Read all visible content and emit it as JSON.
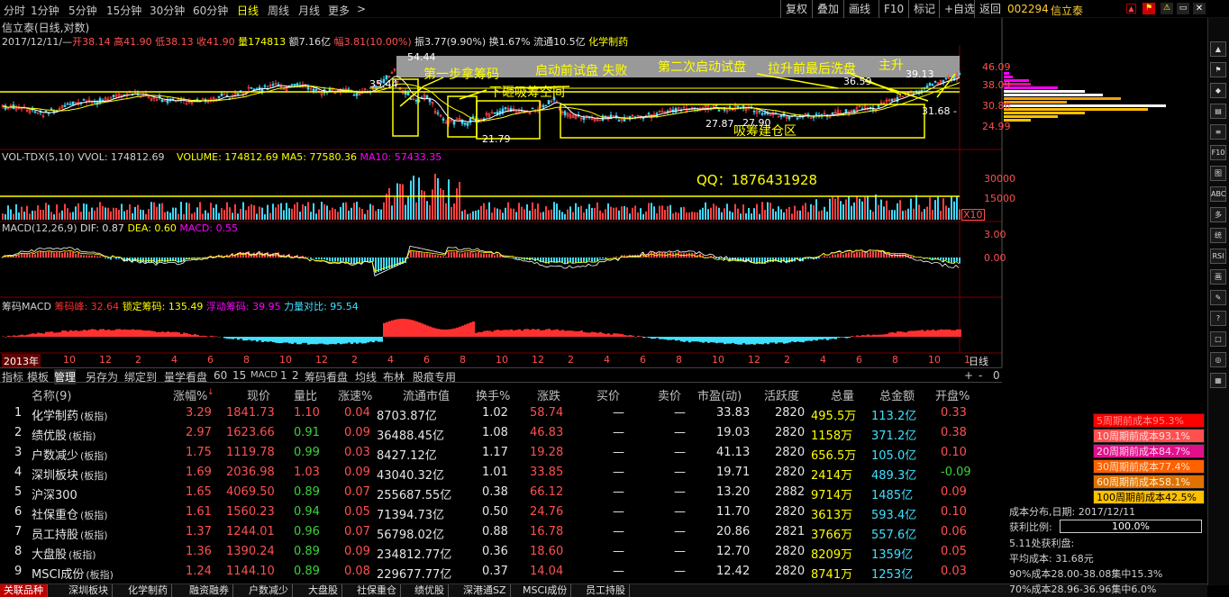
{
  "topbar": {
    "periods": [
      "分时",
      "1分钟",
      "5分钟",
      "15分钟",
      "30分钟",
      "60分钟",
      "日线",
      "周线",
      "月线",
      "更多"
    ],
    "active_period": "日线",
    "more_arrow": ">",
    "buttons": [
      "复权",
      "叠加",
      "画线",
      "F10",
      "标记",
      "+自选",
      "返回"
    ],
    "stock_code": "002294",
    "stock_name": "信立泰"
  },
  "chart_header": {
    "title": "信立泰(日线,对数)",
    "date": "2017/12/11/—",
    "open_label": "开",
    "open": "38.14",
    "high_label": "高",
    "high": "41.90",
    "low_label": "低",
    "low": "38.13",
    "close_label": "收",
    "close": "41.90",
    "vol_label": "量",
    "vol": "174813",
    "amount_label": "额",
    "amount": "7.16亿",
    "change_label": "幅",
    "change": "3.81(10.00%)",
    "amp_label": "振",
    "amp": "3.77(9.90%)",
    "turnover_label": "换",
    "turnover": "1.67%",
    "float_label": "流通",
    "float": "10.5亿",
    "industry": "化学制药"
  },
  "price_axis": [
    "46.09",
    "38.09",
    "30.86",
    "24.99"
  ],
  "annotations": {
    "a1": "第一步拿筹码",
    "a2": "启动前试盘 失败",
    "a3": "第二次启动试盘",
    "a4": "拉升前最后洗盘",
    "a5": "主升",
    "a6": "下砸吸筹空间",
    "a7": "吸筹建仓区",
    "p1": "54.44",
    "p2": "35.44",
    "p3": "21.79",
    "p4": "27.87",
    "p5": "27.90",
    "p6": "36.59",
    "p7": "39.13",
    "p8": "31.68 -",
    "qq": "QQ：1876431928"
  },
  "vol_panel": {
    "title": "VOL-TDX(5,10)",
    "vvol": "VVOL: 174812.69",
    "volume": "VOLUME: 174812.69",
    "ma5": "MA5: 77580.36",
    "ma10": "MA10: 57433.35",
    "axis": [
      "30000",
      "15000"
    ],
    "mult": "X10"
  },
  "macd_panel": {
    "title": "MACD(12,26,9)",
    "dif": "DIF: 0.87",
    "dea": "DEA: 0.60",
    "macd": "MACD: 0.55",
    "axis": [
      "3.00",
      "0.00"
    ]
  },
  "chip_panel": {
    "title": "筹码MACD",
    "peak": "筹码峰: 32.64",
    "lock": "锁定筹码: 135.49",
    "float": "浮动筹码: 39.95",
    "power": "力量对比: 95.54"
  },
  "time_axis": {
    "year": "2013年",
    "months": [
      "10",
      "12",
      "2",
      "4",
      "6",
      "8",
      "10",
      "12",
      "2",
      "4",
      "6",
      "8",
      "10",
      "12",
      "2",
      "4",
      "6",
      "8",
      "10",
      "12",
      "2",
      "4",
      "6",
      "8",
      "10",
      "1"
    ],
    "period_label": "日线"
  },
  "strip": {
    "items": [
      "指标",
      "模板",
      "管理",
      "另存为",
      "绑定到",
      "量学看盘",
      "60",
      "15",
      "MACD",
      "1",
      "2",
      "筹码看盘",
      "均线",
      "布林",
      "股痕专用"
    ],
    "active": "管理",
    "right": [
      "+",
      "-",
      "0"
    ]
  },
  "table": {
    "headers": [
      "名称(9)",
      "涨幅%",
      "现价",
      "量比",
      "涨速%",
      "流通市值",
      "换手%",
      "涨跌",
      "买价",
      "卖价",
      "市盈(动)",
      "活跃度",
      "总量",
      "总金额",
      "开盘%"
    ],
    "rows": [
      {
        "no": "1",
        "name": "化学制药",
        "tag": "(板指)",
        "chg": "3.29",
        "price": "1841.73",
        "vr": "1.10",
        "spd": "0.04",
        "mcap": "8703.87亿",
        "turn": "1.02",
        "diff": "58.74",
        "bid": "—",
        "ask": "—",
        "pe": "33.83",
        "act": "2820",
        "vol": "495.5万",
        "amt": "113.2亿",
        "open": "0.33"
      },
      {
        "no": "2",
        "name": "绩优股",
        "tag": "(板指)",
        "chg": "2.97",
        "price": "1623.66",
        "vr": "0.91",
        "spd": "0.09",
        "mcap": "36488.45亿",
        "turn": "1.08",
        "diff": "46.83",
        "bid": "—",
        "ask": "—",
        "pe": "19.03",
        "act": "2820",
        "vol": "1158万",
        "amt": "371.2亿",
        "open": "0.38"
      },
      {
        "no": "3",
        "name": "户数减少",
        "tag": "(板指)",
        "chg": "1.75",
        "price": "1119.78",
        "vr": "0.99",
        "spd": "0.03",
        "mcap": "8427.12亿",
        "turn": "1.17",
        "diff": "19.28",
        "bid": "—",
        "ask": "—",
        "pe": "41.13",
        "act": "2820",
        "vol": "656.5万",
        "amt": "105.0亿",
        "open": "0.10"
      },
      {
        "no": "4",
        "name": "深圳板块",
        "tag": "(板指)",
        "chg": "1.69",
        "price": "2036.98",
        "vr": "1.03",
        "spd": "0.09",
        "mcap": "43040.32亿",
        "turn": "1.01",
        "diff": "33.85",
        "bid": "—",
        "ask": "—",
        "pe": "19.71",
        "act": "2820",
        "vol": "2414万",
        "amt": "489.3亿",
        "open": "-0.09"
      },
      {
        "no": "5",
        "name": "沪深300",
        "tag": "",
        "chg": "1.65",
        "price": "4069.50",
        "vr": "0.89",
        "spd": "0.07",
        "mcap": "255687.55亿",
        "turn": "0.38",
        "diff": "66.12",
        "bid": "—",
        "ask": "—",
        "pe": "13.20",
        "act": "2882",
        "vol": "9714万",
        "amt": "1485亿",
        "open": "0.09"
      },
      {
        "no": "6",
        "name": "社保重仓",
        "tag": "(板指)",
        "chg": "1.61",
        "price": "1560.23",
        "vr": "0.94",
        "spd": "0.05",
        "mcap": "71394.73亿",
        "turn": "0.50",
        "diff": "24.76",
        "bid": "—",
        "ask": "—",
        "pe": "11.70",
        "act": "2820",
        "vol": "3613万",
        "amt": "593.4亿",
        "open": "0.10"
      },
      {
        "no": "7",
        "name": "员工持股",
        "tag": "(板指)",
        "chg": "1.37",
        "price": "1244.01",
        "vr": "0.96",
        "spd": "0.07",
        "mcap": "56798.02亿",
        "turn": "0.88",
        "diff": "16.78",
        "bid": "—",
        "ask": "—",
        "pe": "20.86",
        "act": "2821",
        "vol": "3766万",
        "amt": "557.6亿",
        "open": "0.06"
      },
      {
        "no": "8",
        "name": "大盘股",
        "tag": "(板指)",
        "chg": "1.36",
        "price": "1390.24",
        "vr": "0.89",
        "spd": "0.09",
        "mcap": "234812.77亿",
        "turn": "0.36",
        "diff": "18.60",
        "bid": "—",
        "ask": "—",
        "pe": "12.70",
        "act": "2820",
        "vol": "8209万",
        "amt": "1359亿",
        "open": "0.05"
      },
      {
        "no": "9",
        "name": "MSCI成份",
        "tag": "(板指)",
        "chg": "1.24",
        "price": "1144.10",
        "vr": "0.89",
        "spd": "0.08",
        "mcap": "229677.77亿",
        "turn": "0.37",
        "diff": "14.04",
        "bid": "—",
        "ask": "—",
        "pe": "12.42",
        "act": "2820",
        "vol": "8741万",
        "amt": "1253亿",
        "open": "0.03"
      }
    ]
  },
  "bottom_tabs": [
    "关联品种",
    "深圳板块",
    "化学制药",
    "融资融券",
    "户数减少",
    "大盘股",
    "社保重仓",
    "绩优股",
    "深港通SZ",
    "MSCI成份",
    "员工持股"
  ],
  "bottom_active": "关联品种",
  "cost_panel": {
    "rows": [
      {
        "label": "5周期前成本95.3%",
        "bg": "#ff0000",
        "fg": "#ff9090"
      },
      {
        "label": "10周期前成本93.1%",
        "bg": "#ff5050",
        "fg": "#ffe0e0"
      },
      {
        "label": "20周期前成本84.7%",
        "bg": "#e0108a",
        "fg": "#ffd0f0"
      },
      {
        "label": "30周期前成本77.4%",
        "bg": "#ff6000",
        "fg": "#ffe0c0"
      },
      {
        "label": "60周期前成本58.1%",
        "bg": "#e07000",
        "fg": "#fff0d0"
      },
      {
        "label": "100周期前成本42.5%",
        "bg": "#ffc000",
        "fg": "#000000"
      }
    ],
    "dist_date": "成本分布,日期: 2017/12/11",
    "profit_label": "获利比例:",
    "profit_value": "100.0%",
    "profit_at": "5.11处获利盘:",
    "avg_cost": "平均成本: 31.68元",
    "c90": "90%成本28.00-38.08集中15.3%",
    "c70": "70%成本28.96-36.96集中6.0%"
  },
  "sidebar_icons": [
    "▲",
    "⚑",
    "◆",
    "▤",
    "≡",
    "F10",
    "图",
    "ABC",
    "多",
    "统",
    "RSI",
    "画",
    "✎",
    "?",
    "□",
    "◎",
    "▦"
  ]
}
